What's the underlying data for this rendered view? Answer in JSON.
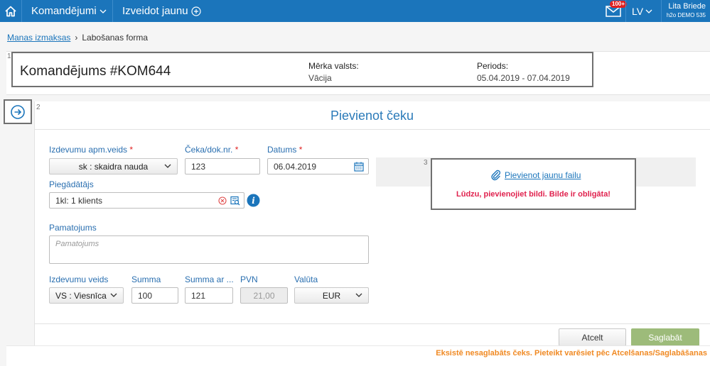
{
  "nav": {
    "menu_trips": "Komandējumi",
    "create_new": "Izveidot jaunu",
    "badge": "100+",
    "language": "LV",
    "user_name": "Lita Briede",
    "company": "h2o DEMO 535"
  },
  "breadcrumb": {
    "parent": "Manas izmaksas",
    "current": "Labošanas forma"
  },
  "steps": {
    "one": "1",
    "two": "2",
    "three": "3"
  },
  "trip": {
    "title": "Komandējums #KOM644",
    "country_label": "Mērka valsts:",
    "country_value": "Vācija",
    "period_label": "Periods:",
    "period_value": "05.04.2019 - 07.04.2019"
  },
  "form": {
    "title": "Pievienot čeku",
    "payment_type_label": "Izdevumu apm.veids",
    "payment_type_value": "sk : skaidra nauda",
    "receipt_no_label": "Čeka/dok.nr.",
    "receipt_no_value": "123",
    "date_label": "Datums",
    "date_value": "06.04.2019",
    "supplier_label": "Piegādātājs",
    "supplier_value": "1kl: 1 klients",
    "justification_label": "Pamatojums",
    "justification_placeholder": "Pamatojums",
    "expense_type_label": "Izdevumu veids",
    "expense_type_value": "VS : Viesnīca",
    "sum_label": "Summa",
    "sum_value": "100",
    "sum_vat_label": "Summa ar ...",
    "sum_vat_value": "121",
    "vat_label": "PVN",
    "vat_value": "21,00",
    "currency_label": "Valūta",
    "currency_value": "EUR",
    "required_mark": "*"
  },
  "attachment": {
    "add_file_label": "Pievienot jaunu failu",
    "error": "Lūdzu, pievienojiet bildi. Bilde ir obligāta!"
  },
  "actions": {
    "cancel": "Atcelt",
    "save": "Saglabāt"
  },
  "notice": "Eksistē nesaglabāts čeks. Pieteikt varēsiet pēc Atcelšanas/Saglabāšanas",
  "colors": {
    "brand": "#1b75bb",
    "error": "#e0224e",
    "warning": "#f08a24",
    "save": "#9dbb7a"
  }
}
